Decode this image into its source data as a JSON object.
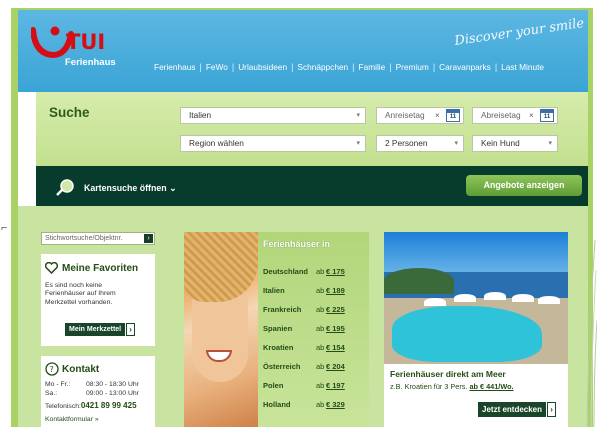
{
  "header": {
    "brand": "TUI",
    "brand_sub": "Ferienhaus",
    "slogan": "Discover your smile",
    "nav": [
      "Ferienhaus",
      "FeWo",
      "Urlaubsideen",
      "Schnäppchen",
      "Familie",
      "Premium",
      "Caravanparks",
      "Last Minute"
    ]
  },
  "search": {
    "title": "Suche",
    "country": "Italien",
    "region_placeholder": "Region wählen",
    "arrival": "Anreisetag",
    "departure": "Abreisetag",
    "calendar_day": "11",
    "persons": "2 Personen",
    "dog": "Kein Hund",
    "map_search": "Kartensuche öffnen",
    "show_offers": "Angebote anzeigen"
  },
  "sidebar": {
    "search_placeholder": "Stichwortsuche/Objektnr.",
    "favorites": {
      "title": "Meine Favoriten",
      "text": "Es sind noch keine Ferienhäuser auf Ihrem Merkzettel vorhanden.",
      "button": "Mein Merkzettel"
    },
    "contact": {
      "title": "Kontakt",
      "row1_label": "Mo - Fr.:",
      "row1_time": "08:30 - 18:30 Uhr",
      "row2_label": "Sa.:",
      "row2_time": "09:00 - 13:00 Uhr",
      "phone_label": "Telefonisch:",
      "phone": "0421 89 99 425",
      "form_link": "Kontaktformular"
    }
  },
  "promo_countries": {
    "title": "Ferienhäuser in",
    "ab": "ab",
    "rows": [
      {
        "country": "Deutschland",
        "price": "€ 175"
      },
      {
        "country": "Italien",
        "price": "€ 189"
      },
      {
        "country": "Frankreich",
        "price": "€ 225"
      },
      {
        "country": "Spanien",
        "price": "€ 195"
      },
      {
        "country": "Kroatien",
        "price": "€ 154"
      },
      {
        "country": "Österreich",
        "price": "€ 204"
      },
      {
        "country": "Polen",
        "price": "€ 197"
      },
      {
        "country": "Holland",
        "price": "€ 329"
      }
    ]
  },
  "promo_sea": {
    "title": "Ferienhäuser direkt am Meer",
    "text": "z.B. Kroatien für 3 Pers.",
    "price": "ab € 441/Wo.",
    "button": "Jetzt entdecken"
  },
  "colors": {
    "brand_red": "#d40e14",
    "dark_green": "#073b2c",
    "light_green": "#c3e08f",
    "header_blue": "#3aa4d6"
  }
}
